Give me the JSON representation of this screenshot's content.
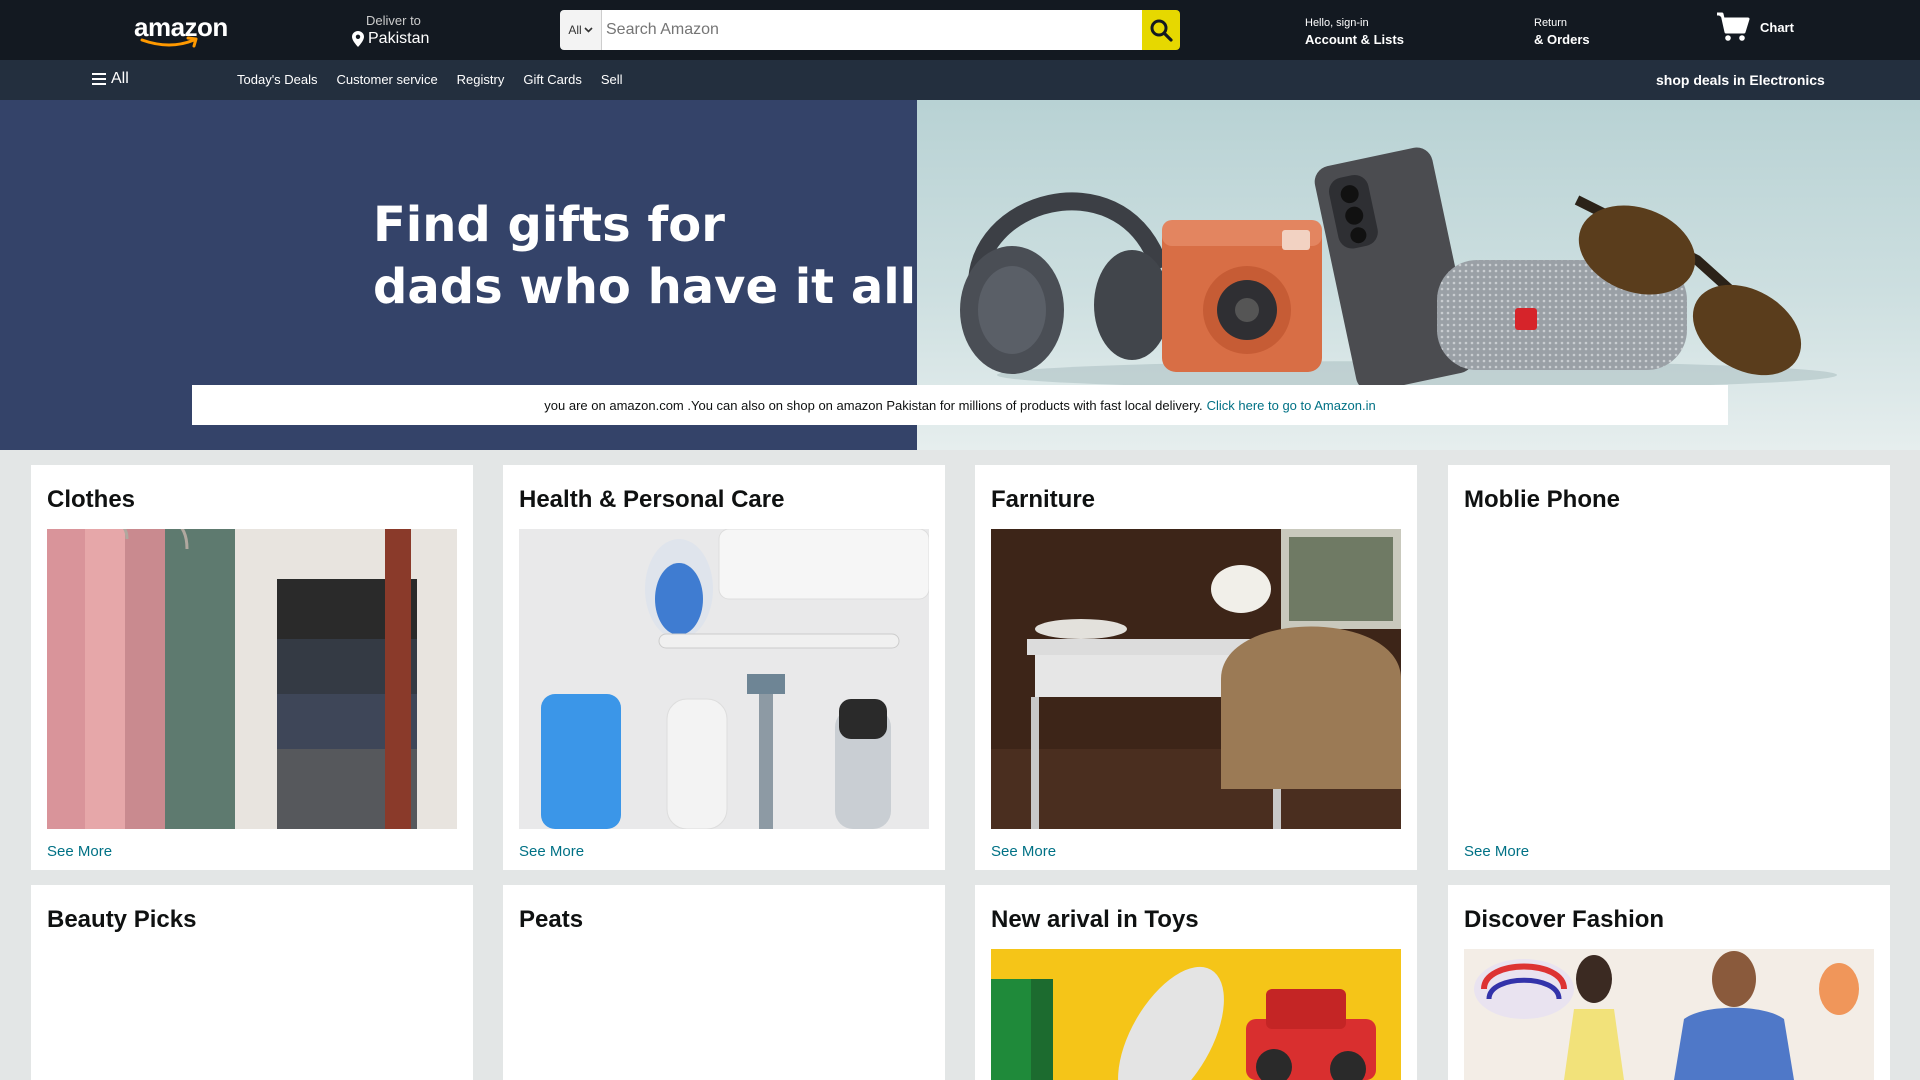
{
  "header": {
    "logo": "amazon",
    "deliver_label": "Deliver to",
    "deliver_location": "Pakistan",
    "search_category": "All",
    "search_placeholder": "Search Amazon",
    "account_greeting": "Hello, sign-in",
    "account_label": "Account & Lists",
    "returns_label": "Return",
    "orders_label": "& Orders",
    "cart_label": "Chart"
  },
  "subnav": {
    "all_label": "All",
    "links": [
      "Today's Deals",
      "Customer service",
      "Registry",
      "Gift Cards",
      "Sell"
    ],
    "promo": "shop deals in Electronics"
  },
  "hero": {
    "title_line1": "Find gifts for",
    "title_line2": "dads who have it all",
    "notice_text": "you are on amazon.com .You can also on shop on amazon Pakistan for millions of products with fast local delivery.",
    "notice_link": "Click here to go to Amazon.in"
  },
  "cards": [
    {
      "title": "Clothes",
      "link": "See More"
    },
    {
      "title": "Health & Personal Care",
      "link": "See More"
    },
    {
      "title": "Farniture",
      "link": "See More"
    },
    {
      "title": "Moblie Phone",
      "link": "See More"
    },
    {
      "title": "Beauty Picks",
      "link": ""
    },
    {
      "title": "Peats",
      "link": ""
    },
    {
      "title": "New arival in Toys",
      "link": ""
    },
    {
      "title": "Discover Fashion",
      "link": ""
    }
  ],
  "colors": {
    "nav_bg": "#131921",
    "subnav_bg": "#232f3e",
    "search_button": "#e6d800",
    "hero_left": "#344369",
    "link": "#007185",
    "page_bg": "#e3e6e6"
  },
  "icons": [
    "location-pin-icon",
    "search-icon",
    "cart-icon",
    "hamburger-icon",
    "chevron-down-icon"
  ]
}
